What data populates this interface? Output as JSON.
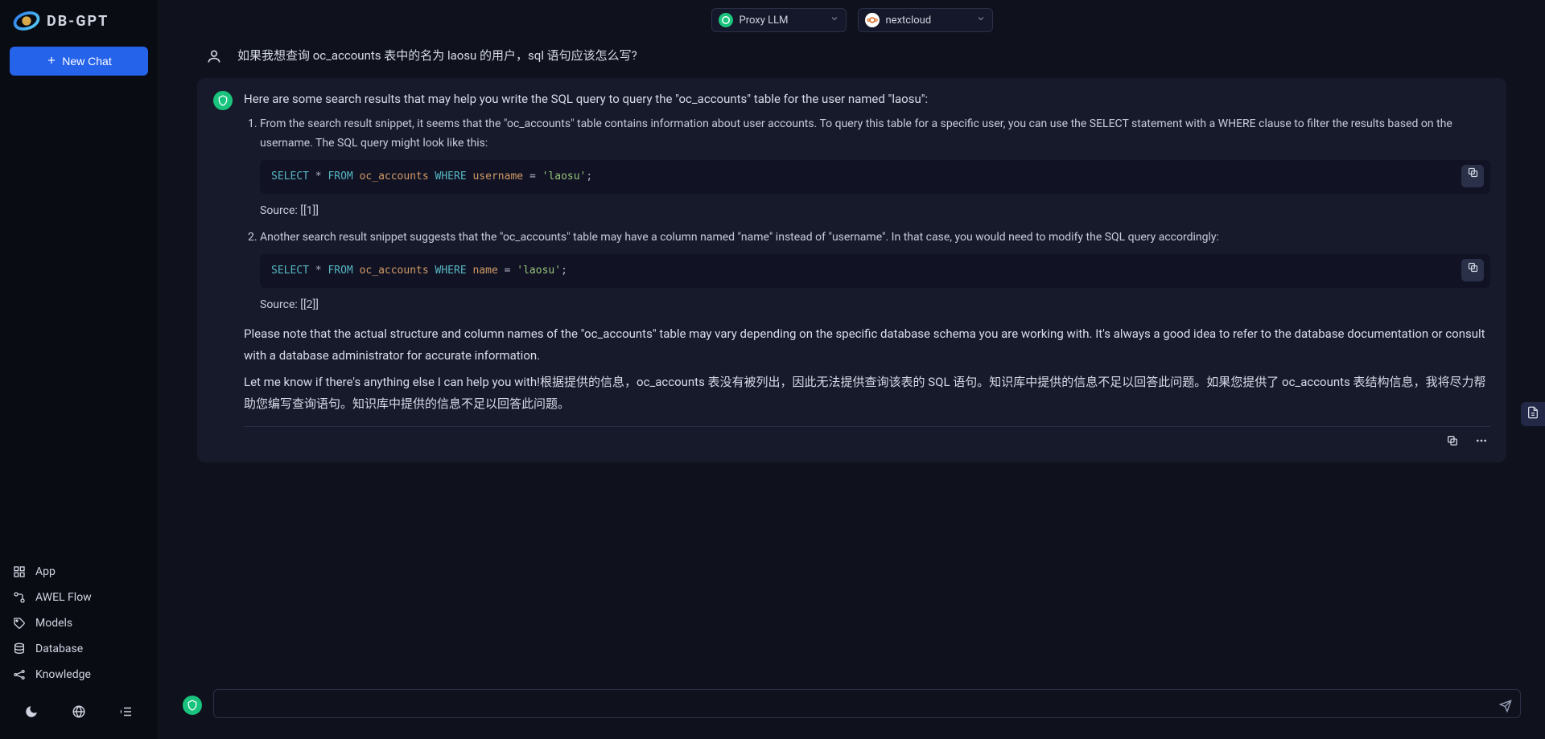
{
  "app": {
    "name": "DB-GPT"
  },
  "sidebar": {
    "new_chat_label": "New Chat",
    "nav": [
      {
        "label": "App",
        "icon": "grid-icon"
      },
      {
        "label": "AWEL Flow",
        "icon": "flow-icon"
      },
      {
        "label": "Models",
        "icon": "tag-icon"
      },
      {
        "label": "Database",
        "icon": "database-icon"
      },
      {
        "label": "Knowledge",
        "icon": "knowledge-icon"
      }
    ]
  },
  "topbar": {
    "model_select": {
      "label": "Proxy LLM"
    },
    "db_select": {
      "label": "nextcloud"
    }
  },
  "chat": {
    "user_message": "如果我想查询 oc_accounts 表中的名为 laosu 的用户，sql 语句应该怎么写?",
    "assistant": {
      "intro": "Here are some search results that may help you write the SQL query to query the \"oc_accounts\" table for the user named \"laosu\":",
      "items": [
        {
          "text": "From the search result snippet, it seems that the \"oc_accounts\" table contains information about user accounts. To query this table for a specific user, you can use the SELECT statement with a WHERE clause to filter the results based on the username. The SQL query might look like this:",
          "sql": {
            "select_kw": "SELECT",
            "star": "*",
            "from_kw": "FROM",
            "table": "oc_accounts",
            "where_kw": "WHERE",
            "col": "username",
            "eq": "=",
            "val": "'laosu'",
            "semi": ";"
          },
          "source": "Source: [[1]]"
        },
        {
          "text": "Another search result snippet suggests that the \"oc_accounts\" table may have a column named \"name\" instead of \"username\". In that case, you would need to modify the SQL query accordingly:",
          "sql": {
            "select_kw": "SELECT",
            "star": "*",
            "from_kw": "FROM",
            "table": "oc_accounts",
            "where_kw": "WHERE",
            "col": "name",
            "eq": "=",
            "val": "'laosu'",
            "semi": ";"
          },
          "source": "Source: [[2]]"
        }
      ],
      "note": "Please note that the actual structure and column names of the \"oc_accounts\" table may vary depending on the specific database schema you are working with. It's always a good idea to refer to the database documentation or consult with a database administrator for accurate information.",
      "closing": "Let me know if there's anything else I can help you with!根据提供的信息，oc_accounts 表没有被列出，因此无法提供查询该表的 SQL 语句。知识库中提供的信息不足以回答此问题。如果您提供了 oc_accounts 表结构信息，我将尽力帮助您编写查询语句。知识库中提供的信息不足以回答此问题。"
    }
  },
  "input": {
    "placeholder": ""
  },
  "colors": {
    "primary": "#2563eb",
    "ai_green": "#19c37d",
    "card_bg": "#171a2b",
    "code_bg": "#111324"
  }
}
